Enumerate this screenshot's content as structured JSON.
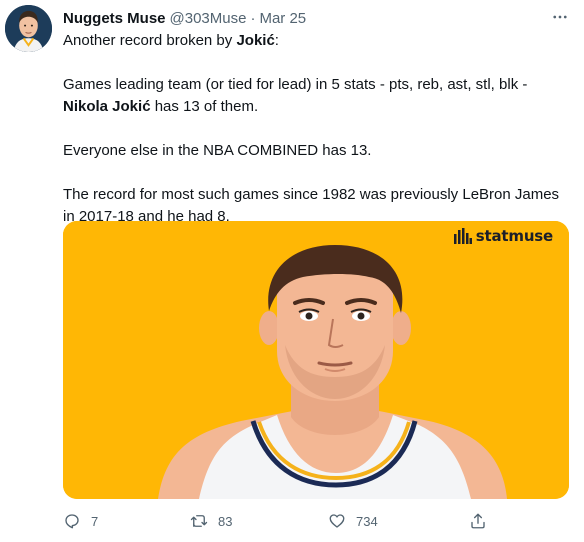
{
  "tweet": {
    "display_name": "Nuggets Muse",
    "handle": "@303Muse",
    "separator": "·",
    "date": "Mar 25",
    "line1_text": "Another record broken by ",
    "line1_bold": "Jokić",
    "line1_end": ":",
    "para2_text": "Games leading team (or tied for lead) in 5 stats - pts, reb, ast, stl, blk - ",
    "para2_bold": "Nikola Jokić",
    "para2_end": " has 13 of them.",
    "para3": "Everyone else in the NBA COMBINED has 13.",
    "para4": "The record for most such games since 1982 was previously LeBron James in 2017-18 and he had 8."
  },
  "media": {
    "brand_label": "statmuse",
    "background_color": "#ffb705"
  },
  "actions": {
    "reply_count": "7",
    "retweet_count": "83",
    "like_count": "734"
  },
  "icons": {
    "more": "more-icon",
    "reply": "reply-icon",
    "retweet": "retweet-icon",
    "like": "heart-icon",
    "share": "share-icon"
  },
  "colors": {
    "text_primary": "#0f1419",
    "text_secondary": "#536471",
    "media_bg": "#ffb705"
  }
}
